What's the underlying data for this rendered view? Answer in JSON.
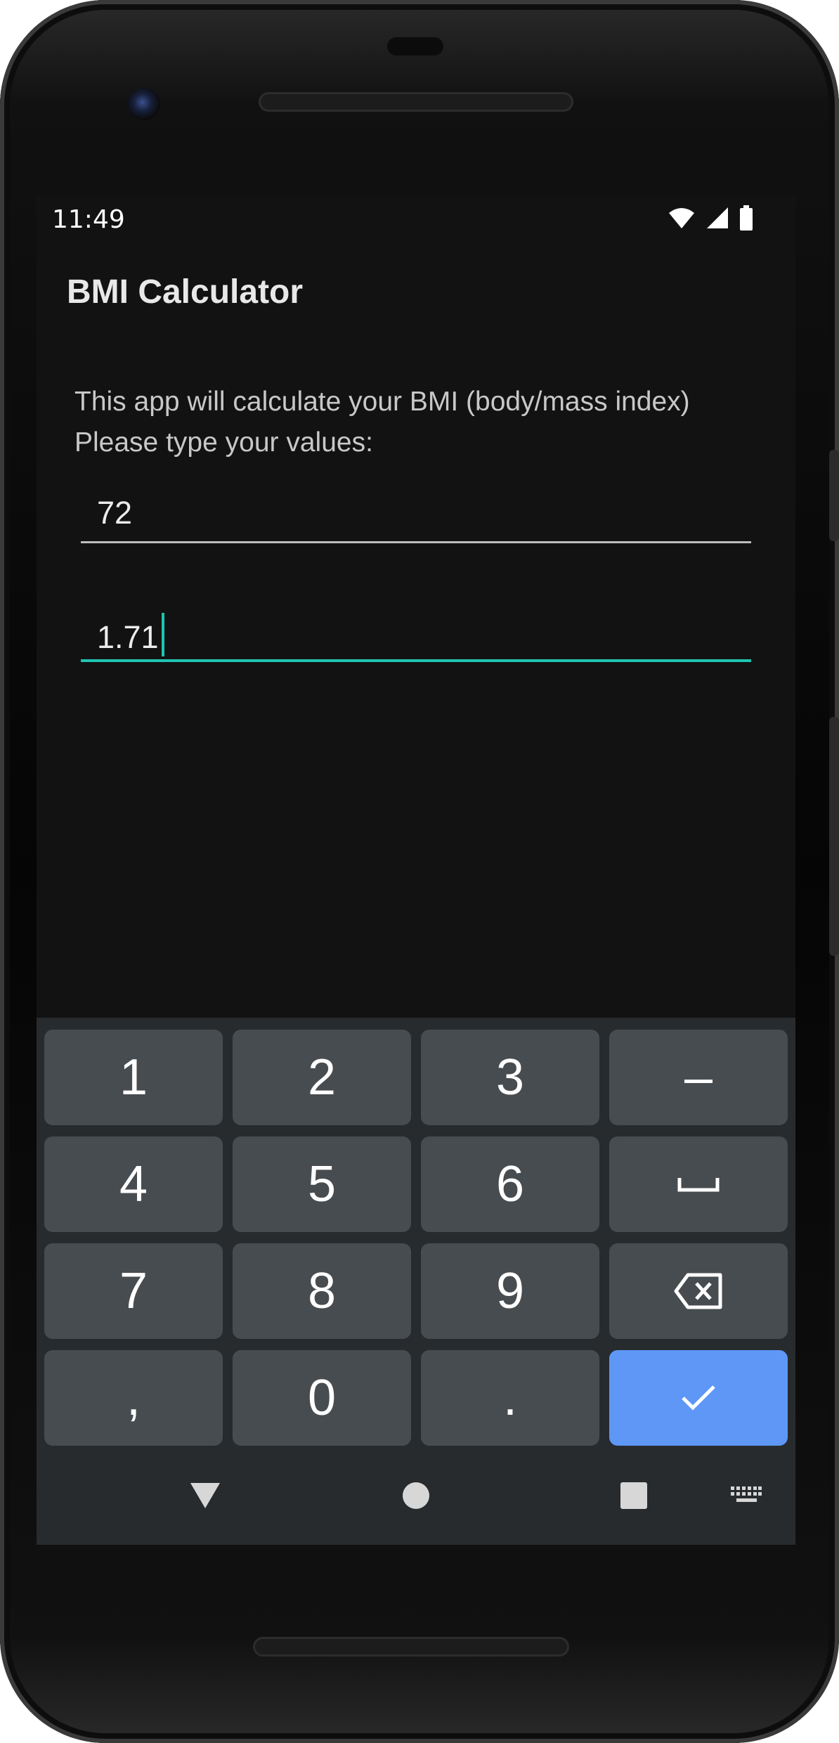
{
  "status_bar": {
    "time": "11:49",
    "icons": [
      "wifi-icon",
      "cell-signal-icon",
      "battery-icon"
    ]
  },
  "app": {
    "title": "BMI Calculator",
    "intro_line1": "This app will calculate your BMI (body/mass index)",
    "intro_line2": "Please type your values:"
  },
  "fields": {
    "weight_value": "72",
    "height_value": "1.71"
  },
  "keyboard": {
    "keys": [
      "1",
      "2",
      "3",
      "–",
      "4",
      "5",
      "6",
      "space-icon",
      "7",
      "8",
      "9",
      "backspace-icon",
      ",",
      "0",
      ".",
      "checkmark-icon"
    ],
    "accent_color": "#5e97f6"
  },
  "nav_bar": {
    "icons": [
      "back-icon",
      "home-icon",
      "recents-icon",
      "keyboard-switch-icon"
    ]
  },
  "colors": {
    "focus_underline": "#1fc4b1",
    "background": "#121212"
  }
}
